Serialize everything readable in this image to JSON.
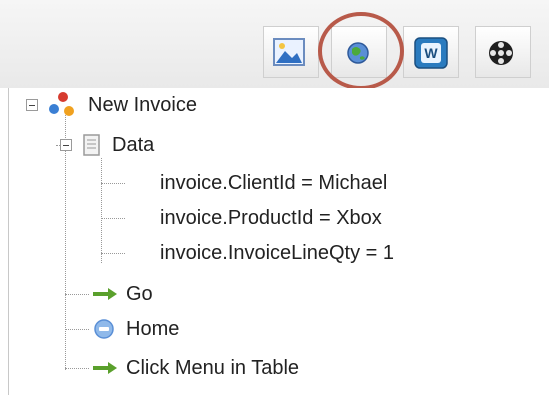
{
  "toolbar": {
    "buttons": [
      {
        "name": "image-button",
        "icon": "image-icon"
      },
      {
        "name": "globe-button",
        "icon": "globe-icon",
        "highlighted": true
      },
      {
        "name": "word-button",
        "icon": "word-icon"
      },
      {
        "name": "save-button",
        "icon": "film-reel-icon"
      }
    ],
    "highlight_color": "#b85a4a"
  },
  "tree": {
    "root": {
      "label": "New Invoice",
      "icon": "puzzle-icon"
    },
    "data_node": {
      "label": "Data",
      "icon": "document-icon"
    },
    "data_items": [
      "invoice.ClientId = Michael",
      "invoice.ProductId = Xbox",
      "invoice.InvoiceLineQty = 1"
    ],
    "steps": [
      {
        "label": "Go",
        "icon": "green-arrow-icon"
      },
      {
        "label": "Home",
        "icon": "blue-globe-icon"
      },
      {
        "label": "Click Menu in Table",
        "icon": "green-arrow-icon"
      }
    ]
  },
  "colors": {
    "arrow_green": "#5aa02c",
    "globe_blue": "#5a8fd6"
  }
}
